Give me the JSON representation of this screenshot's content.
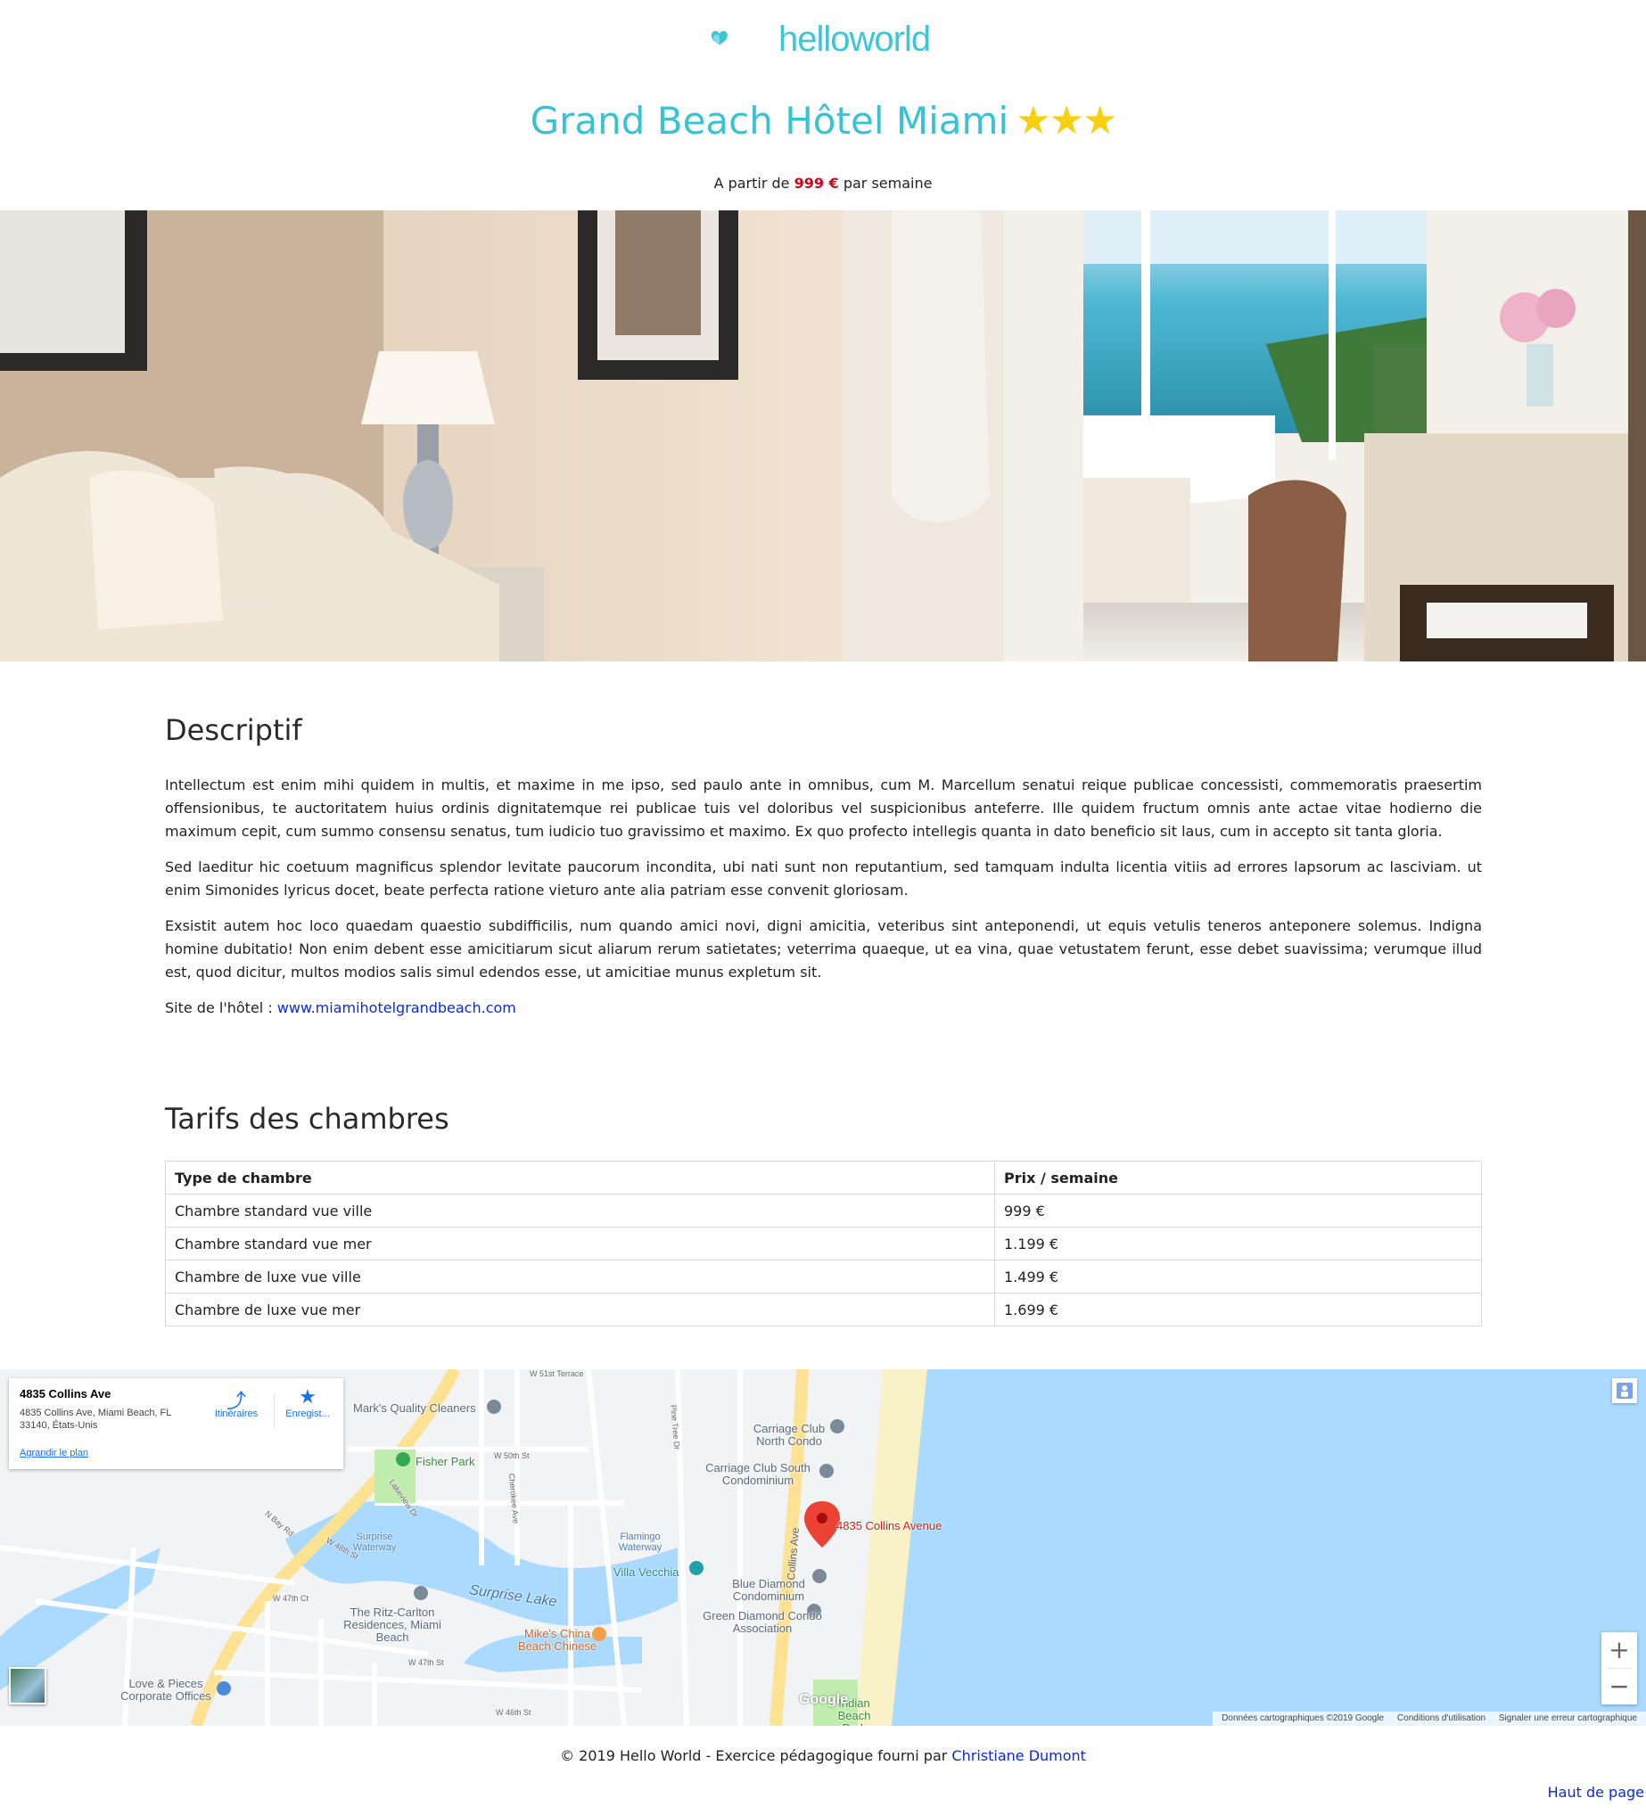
{
  "header": {
    "logo_text": "helloworld",
    "hotel_name": "Grand Beach Hôtel Miami",
    "stars": "★★★",
    "price_prefix": "A partir de",
    "price": "999 €",
    "price_suffix": "par semaine"
  },
  "description": {
    "title": "Descriptif",
    "paragraphs": [
      "Intellectum est enim mihi quidem in multis, et maxime in me ipso, sed paulo ante in omnibus, cum M. Marcellum senatui reique publicae concessisti, commemoratis praesertim offensionibus, te auctoritatem huius ordinis dignitatemque rei publicae tuis vel doloribus vel suspicionibus anteferre. Ille quidem fructum omnis ante actae vitae hodierno die maximum cepit, cum summo consensu senatus, tum iudicio tuo gravissimo et maximo. Ex quo profecto intellegis quanta in dato beneficio sit laus, cum in accepto sit tanta gloria.",
      "Sed laeditur hic coetuum magnificus splendor levitate paucorum incondita, ubi nati sunt non reputantium, sed tamquam indulta licentia vitiis ad errores lapsorum ac lasciviam. ut enim Simonides lyricus docet, beate perfecta ratione vieturo ante alia patriam esse convenit gloriosam.",
      "Exsistit autem hoc loco quaedam quaestio subdifficilis, num quando amici novi, digni amicitia, veteribus sint anteponendi, ut equis vetulis teneros anteponere solemus. Indigna homine dubitatio! Non enim debent esse amicitiarum sicut aliarum rerum satietates; veterrima quaeque, ut ea vina, quae vetustatem ferunt, esse debet suavissima; verumque illud est, quod dicitur, multos modios salis simul edendos esse, ut amicitiae munus expletum sit."
    ],
    "site_label": "Site de l'hôtel :",
    "site_link": "www.miamihotelgrandbeach.com"
  },
  "rates": {
    "title": "Tarifs des chambres",
    "columns": [
      "Type de chambre",
      "Prix / semaine"
    ],
    "rows": [
      [
        "Chambre standard vue ville",
        "999 €"
      ],
      [
        "Chambre standard vue mer",
        "1.199 €"
      ],
      [
        "Chambre de luxe vue ville",
        "1.499 €"
      ],
      [
        "Chambre de luxe vue mer",
        "1.699 €"
      ]
    ]
  },
  "map": {
    "card_title": "4835 Collins Ave",
    "card_address": "4835 Collins Ave, Miami Beach, FL 33140, États-Unis",
    "directions_label": "Itinéraires",
    "save_label": "Enregist...",
    "enlarge_label": "Agrandir le plan",
    "marker_label": "4835 Collins Avenue",
    "labels": {
      "marks_cleaners": "Mark's Quality Cleaners",
      "fisher_park": "Fisher Park",
      "carriage_north": "Carriage Club North Condo",
      "carriage_south": "Carriage Club South Condominium",
      "surprise_waterway": "Surprise Waterway",
      "flamingo_waterway": "Flamingo Waterway",
      "villa_vecchia": "Villa Vecchia",
      "surprise_lake": "Surprise Lake",
      "ritz": "The Ritz-Carlton Residences, Miami Beach",
      "blue_diamond": "Blue Diamond Condominium",
      "green_diamond": "Green Diamond Condo Association",
      "mikes": "Mike's China Beach Chinese",
      "love_pieces": "Love & Pieces Corporate Offices",
      "indian_beach": "Indian Beach Park",
      "collins_ave": "Collins Ave",
      "w51": "W 51st Terrace",
      "w50": "W 50th St",
      "w47": "W 47th St",
      "w47ct": "W 47th Ct",
      "w46": "W 46th St",
      "w48": "W 48th St",
      "pine_tree": "Pine Tree Dr",
      "n_bay": "N Bay Rd",
      "lakeview": "Lakeview Dr",
      "cherokee": "Cherokee Ave"
    },
    "google": "Google",
    "attrib_data": "Données cartographiques ©2019 Google",
    "attrib_terms": "Conditions d'utilisation",
    "attrib_report": "Signaler une erreur cartographique"
  },
  "footer": {
    "text": "© 2019 Hello World - Exercice pédagogique fourni par",
    "author": "Christiane Dumont",
    "back_to_top": "Haut de page"
  }
}
